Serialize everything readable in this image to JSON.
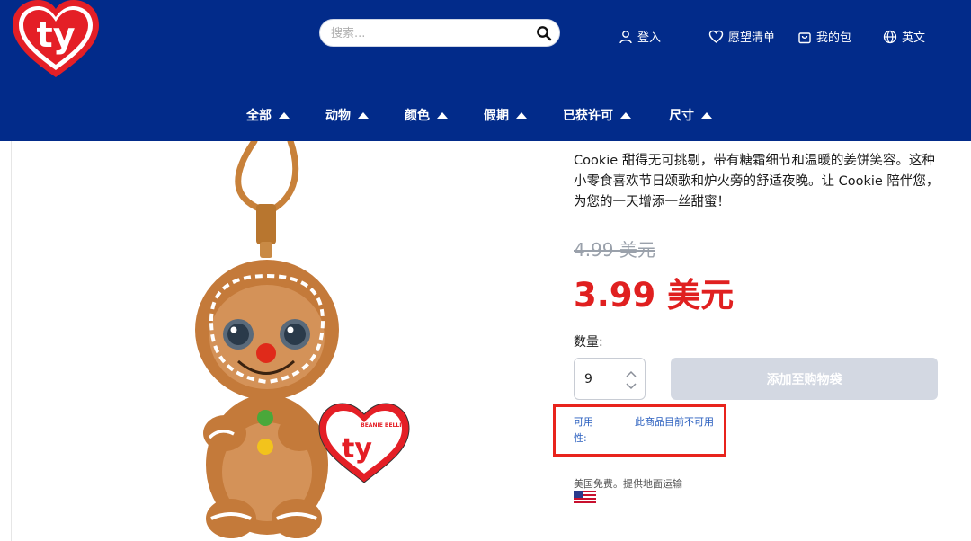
{
  "header": {
    "logo_text": "ty",
    "search": {
      "placeholder": "搜索...",
      "value": ""
    },
    "utility": {
      "login": "登入",
      "wishlist": "愿望清单",
      "bag": "我的包",
      "language": "英文"
    },
    "nav": [
      {
        "label": "全部"
      },
      {
        "label": "动物"
      },
      {
        "label": "颜色"
      },
      {
        "label": "假期"
      },
      {
        "label": "已获许可"
      },
      {
        "label": "尺寸"
      }
    ]
  },
  "product": {
    "description": "Cookie 甜得无可挑剔，带有糖霜细节和温暖的姜饼笑容。这种小零食喜欢节日颂歌和炉火旁的舒适夜晚。让 Cookie 陪伴您，为您的一天增添一丝甜蜜！",
    "old_price": "4.99 美元",
    "new_price": "3.99 美元",
    "quantity_label": "数量:",
    "quantity_value": "9",
    "add_to_bag": "添加至购物袋",
    "availability_label": "可用性:",
    "availability_value": "此商品目前不可用",
    "shipping": "美国免费。提供地面运输",
    "tag_text": "BEANIE BELLIES"
  },
  "colors": {
    "header_bg": "#022b8a",
    "price_red": "#e02020",
    "highlight_border": "#e8231c",
    "disabled_button": "#d3d8e2",
    "link_blue": "#2a5fbf"
  }
}
